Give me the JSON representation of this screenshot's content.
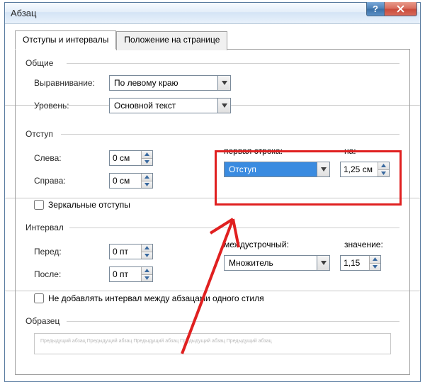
{
  "window": {
    "title": "Абзац"
  },
  "tabs": {
    "active": "Отступы и интервалы",
    "inactive": "Положение на странице"
  },
  "groups": {
    "general": "Общие",
    "indent": "Отступ",
    "interval": "Интервал",
    "sample": "Образец"
  },
  "general": {
    "alignment_label": "Выравнивание:",
    "alignment_value": "По левому краю",
    "level_label": "Уровень:",
    "level_value": "Основной текст"
  },
  "indent": {
    "left_label": "Слева:",
    "left_value": "0 см",
    "right_label": "Справа:",
    "right_value": "0 см",
    "mirror_label": "Зеркальные отступы",
    "firstline_label": "первая строка:",
    "firstline_value": "Отступ",
    "by_label": "на:",
    "by_value": "1,25 см"
  },
  "interval": {
    "before_label": "Перед:",
    "before_value": "0 пт",
    "after_label": "После:",
    "after_value": "0 пт",
    "linespacing_label": "междустрочный:",
    "linespacing_value": "Множитель",
    "value_label": "значение:",
    "value_value": "1,15",
    "noadd_label": "Не добавлять интервал между абзацами одного стиля"
  },
  "sample": {
    "text": "Предыдущий абзац Предыдущий абзац Предыдущий абзац Предыдущий абзац Предыдущий абзац"
  }
}
